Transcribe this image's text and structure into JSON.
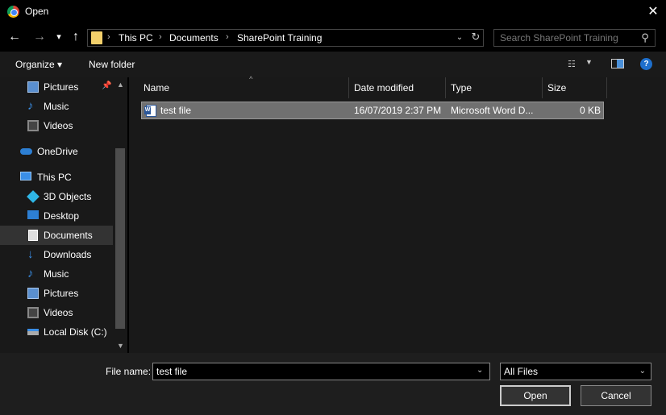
{
  "window": {
    "title": "Open",
    "close_glyph": "✕"
  },
  "nav": {
    "back_glyph": "←",
    "forward_glyph": "→",
    "recent_glyph": "▾",
    "up_glyph": "↑",
    "breadcrumbs": [
      "This PC",
      "Documents",
      "SharePoint Training"
    ],
    "separator": "›",
    "dropdown_glyph": "⌄",
    "refresh_glyph": "↻",
    "search_placeholder": "Search SharePoint Training",
    "search_glyph": "⚲"
  },
  "toolbar": {
    "organize_label": "Organize ▾",
    "new_folder_label": "New folder",
    "view_glyph": "☷",
    "view_dd_glyph": "▼",
    "help_glyph": "?"
  },
  "sidebar": {
    "items": [
      {
        "label": "Pictures",
        "icon": "pictures-icon",
        "pinned": true
      },
      {
        "label": "Music",
        "icon": "music-icon"
      },
      {
        "label": "Videos",
        "icon": "videos-icon"
      },
      {
        "label": "OneDrive",
        "icon": "onedrive-icon"
      },
      {
        "label": "This PC",
        "icon": "this-pc-icon"
      },
      {
        "label": "3D Objects",
        "icon": "3d-objects-icon"
      },
      {
        "label": "Desktop",
        "icon": "desktop-icon"
      },
      {
        "label": "Documents",
        "icon": "documents-icon",
        "selected": true
      },
      {
        "label": "Downloads",
        "icon": "downloads-icon"
      },
      {
        "label": "Music",
        "icon": "music-icon"
      },
      {
        "label": "Pictures",
        "icon": "pictures-icon"
      },
      {
        "label": "Videos",
        "icon": "videos-icon"
      },
      {
        "label": "Local Disk (C:)",
        "icon": "local-disk-icon"
      }
    ],
    "pin_glyph": "📌",
    "scroll_up_glyph": "▲",
    "scroll_down_glyph": "▼"
  },
  "filelist": {
    "columns": [
      "Name",
      "Date modified",
      "Type",
      "Size"
    ],
    "sort_glyph": "^",
    "rows": [
      {
        "name": "test file",
        "date": "16/07/2019 2:37 PM",
        "type": "Microsoft Word D...",
        "size": "0 KB"
      }
    ]
  },
  "bottom": {
    "file_name_label": "File name:",
    "file_name_value": "test file",
    "filter_value": "All Files",
    "dd_glyph": "⌄",
    "open_label": "Open",
    "cancel_label": "Cancel"
  },
  "colors": {
    "background": "#191919",
    "selected_row": "#707070",
    "accent": "#1e6fcc",
    "folder": "#f3d06b"
  }
}
